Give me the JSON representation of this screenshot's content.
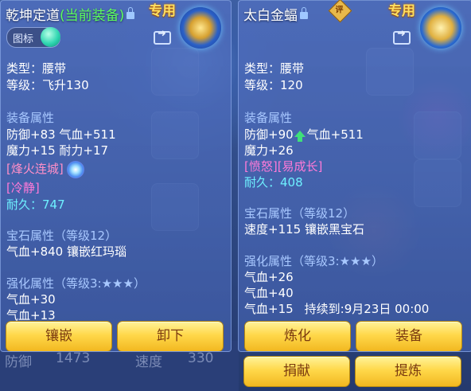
{
  "left_panel": {
    "item_name": "乾坤定道",
    "current_equip": "(当前装备)",
    "exclusive": "专用",
    "icon_toggle_label": "图标",
    "type_line": "类型：腰带",
    "level_line": "等级：飞升130",
    "equip_attr_title": "装备属性",
    "attr_line1": "防御+83 气血+511",
    "attr_line2": "魔力+15 耐力+17",
    "special_skill": "[烽火连城]",
    "special_effect": "[冷静]",
    "durability": "耐久：747",
    "gem_title": "宝石属性（等级12）",
    "gem_line": "气血+840 镶嵌红玛瑙",
    "enhance_title": "强化属性（等级3:★★★）",
    "enhance_line1": "气血+30",
    "enhance_line2": "气血+13",
    "buttons": [
      "镶嵌",
      "卸下"
    ]
  },
  "right_panel": {
    "item_name": "太白金蝠",
    "badge": "评",
    "exclusive": "专用",
    "type_line": "类型：腰带",
    "level_line": "等级：120",
    "equip_attr_title": "装备属性",
    "attr_line1_a": "防御+90",
    "attr_line1_b": "气血+511",
    "attr_line2": "魔力+26",
    "special_effect": "[愤怒][易成长]",
    "durability": "耐久：408",
    "gem_title": "宝石属性（等级12）",
    "gem_line": "速度+115 镶嵌黑宝石",
    "enhance_title": "强化属性（等级3:★★★）",
    "enhance_line1": "气血+26",
    "enhance_line2": "气血+40",
    "enhance_line3": "气血+15",
    "duration": "持续到:9月23日 00:00",
    "buttons": [
      "炼化",
      "装备",
      "捐献",
      "提炼"
    ]
  },
  "background": {
    "bottom_stat_label": "防御",
    "bottom_stat_value": "1473",
    "bottom_speed_label": "速度",
    "bottom_speed_value": "330"
  }
}
